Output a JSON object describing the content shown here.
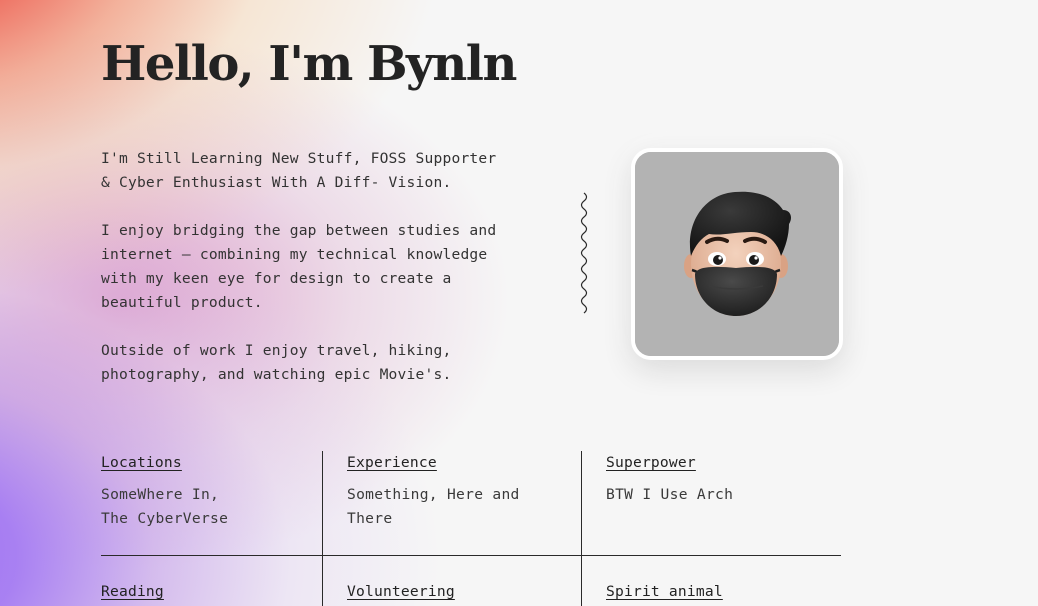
{
  "header": {
    "title": "Hello, I'm Bynln"
  },
  "bio": {
    "paragraph_1": "I'm Still Learning New Stuff, FOSS Supporter\n& Cyber Enthusiast With A Diff- Vision.",
    "paragraph_2": "I enjoy bridging the gap between studies and\ninternet — combining my technical knowledge\nwith my keen eye for design to create a\nbeautiful product.",
    "paragraph_3": "Outside of work I enjoy travel, hiking,\nphotography, and watching epic Movie's."
  },
  "avatar": {
    "icon": "memoji-avatar-with-mask",
    "background_color": "#b3b3b3"
  },
  "facts": {
    "locations": {
      "title": "Locations",
      "text": "SomeWhere In,\nThe CyberVerse"
    },
    "experience": {
      "title": "Experience",
      "text": "Something, Here and\nThere"
    },
    "superpower": {
      "title": "Superpower",
      "text": "BTW I Use Arch"
    },
    "reading": {
      "title": "Reading"
    },
    "volunteering": {
      "title": "Volunteering"
    },
    "spirit_animal": {
      "title": "Spirit animal"
    }
  },
  "colors": {
    "accent_red": "#ec4b3c",
    "accent_purple": "#9b6cf2",
    "text": "#2a2a2a",
    "page_background": "#f6f6f6"
  }
}
